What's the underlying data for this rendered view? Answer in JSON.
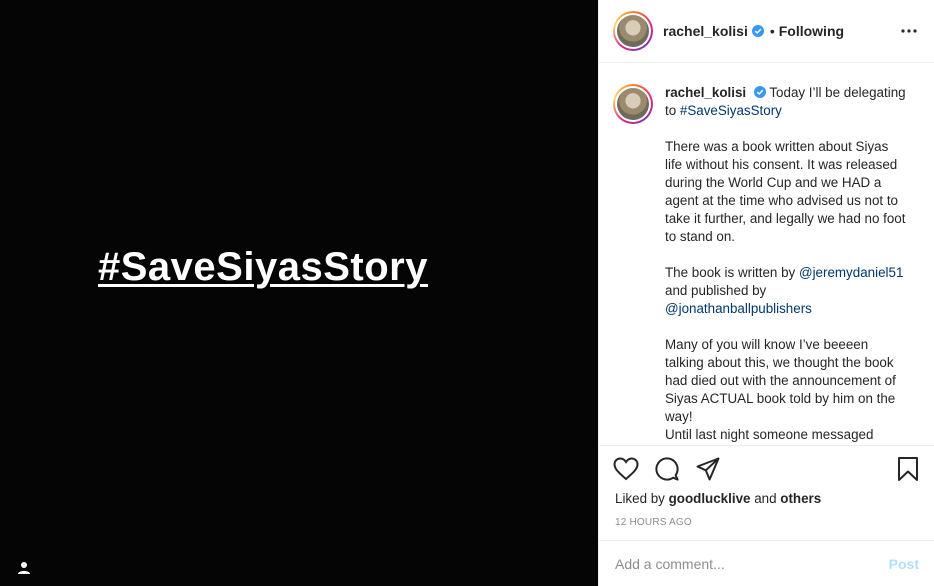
{
  "media": {
    "overlay_text": "#SaveSiyasStory",
    "user_tag_icon": "user-tag-icon"
  },
  "header": {
    "username": "rachel_kolisi",
    "verified_icon": "verified-badge-icon",
    "separator": "•",
    "follow_status": "Following",
    "more_icon": "more-options-icon"
  },
  "caption": {
    "username": "rachel_kolisi",
    "intro": "Today I’ll be delegating to",
    "hashtag": "#SaveSiyasStory",
    "para1": "There was a book written about Siyas life without his consent. It was released during the World Cup and we HAD a agent at the time who advised us not to take it further, and legally we had no foot to stand on.",
    "para2_prefix": "The book is written by",
    "mention1": "@jeremydaniel51",
    "para2_mid": "and published by",
    "mention2": "@jonathanballpublishers",
    "para3": "Many of you will know I’ve beeeen talking about this, we thought the book had died out with the announcement of Siyas ACTUAL book told by him on the way!",
    "para4": "Until last night someone messaged"
  },
  "actions": {
    "like_icon": "heart-icon",
    "comment_icon": "comment-icon",
    "share_icon": "share-icon",
    "save_icon": "bookmark-icon",
    "liked_prefix": "Liked by",
    "liked_user": "goodlucklive",
    "liked_and": "and",
    "liked_others": "others",
    "timestamp": "12 HOURS AGO"
  },
  "comment": {
    "placeholder": "Add a comment...",
    "post_label": "Post"
  },
  "colors": {
    "verified": "#3897f0",
    "link": "#00376b",
    "post_disabled": "#b2dffc"
  }
}
